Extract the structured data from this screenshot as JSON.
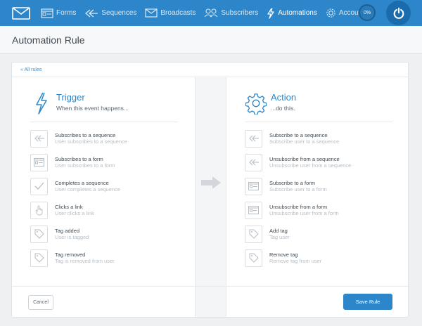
{
  "nav": {
    "items": [
      {
        "label": "Forms",
        "icon": "forms-icon"
      },
      {
        "label": "Sequences",
        "icon": "sequences-icon"
      },
      {
        "label": "Broadcasts",
        "icon": "broadcasts-icon"
      },
      {
        "label": "Subscribers",
        "icon": "subscribers-icon"
      },
      {
        "label": "Automations",
        "icon": "automations-icon",
        "active": true
      },
      {
        "label": "Account",
        "icon": "gear-icon"
      }
    ],
    "progress": "0%"
  },
  "page": {
    "title": "Automation Rule"
  },
  "breadcrumb": "« All rules",
  "trigger": {
    "title": "Trigger",
    "subtitle": "When this event happens...",
    "options": [
      {
        "title": "Subscribes to a sequence",
        "desc": "User subscribes to a sequence",
        "icon": "sequence-icon"
      },
      {
        "title": "Subscribes to a form",
        "desc": "User subscribes to a form",
        "icon": "form-icon"
      },
      {
        "title": "Completes a sequence",
        "desc": "User completes a sequence",
        "icon": "check-icon"
      },
      {
        "title": "Clicks a link",
        "desc": "User clicks a link",
        "icon": "pointer-icon"
      },
      {
        "title": "Tag added",
        "desc": "User is tagged",
        "icon": "tag-icon"
      },
      {
        "title": "Tag removed",
        "desc": "Tag is removed from user",
        "icon": "tag-icon"
      }
    ]
  },
  "action": {
    "title": "Action",
    "subtitle": "...do this.",
    "options": [
      {
        "title": "Subscribe to a sequence",
        "desc": "Subscribe user to a sequence",
        "icon": "sequence-icon"
      },
      {
        "title": "Unsubscribe from a sequence",
        "desc": "Unsubscribe user from a sequence",
        "icon": "sequence-icon"
      },
      {
        "title": "Subscribe to a form",
        "desc": "Subscribe user to a form",
        "icon": "form-icon"
      },
      {
        "title": "Unsubscribe from a form",
        "desc": "Unsubscribe user from a form",
        "icon": "form-icon"
      },
      {
        "title": "Add tag",
        "desc": "Tag user",
        "icon": "tag-icon"
      },
      {
        "title": "Remove tag",
        "desc": "Remove tag from user",
        "icon": "tag-icon"
      }
    ]
  },
  "buttons": {
    "cancel": "Cancel",
    "save": "Save Rule"
  },
  "colors": {
    "brand": "#2c86c9",
    "muted": "#b6bec5"
  }
}
